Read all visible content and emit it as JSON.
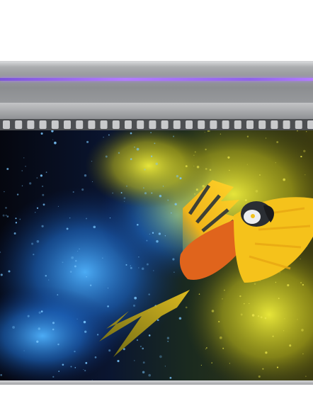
{
  "scene": {
    "subject": "uv-flatbed-printer-printing-parrot",
    "colors": {
      "background": "#ffffff",
      "printer_metal": "#9c9ea1",
      "uv_light": "#9b6cf0",
      "powder_blue": "#2a7fd8",
      "powder_yellow": "#d7d21a",
      "parrot_orange": "#e0641c",
      "parrot_yellow": "#f5c21b"
    }
  }
}
